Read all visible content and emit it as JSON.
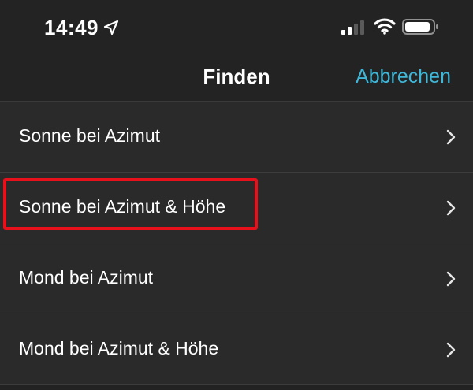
{
  "status_bar": {
    "time": "14:49",
    "icons": [
      "location-arrow-icon",
      "signal-icon",
      "wifi-icon",
      "battery-icon"
    ]
  },
  "nav": {
    "title": "Finden",
    "cancel_label": "Abbrechen"
  },
  "list": {
    "items": [
      {
        "label": "Sonne bei Azimut"
      },
      {
        "label": "Sonne bei Azimut & Höhe"
      },
      {
        "label": "Mond bei Azimut"
      },
      {
        "label": "Mond bei Azimut & Höhe"
      }
    ]
  },
  "colors": {
    "background": "#222222",
    "row_background": "#2a2a2a",
    "accent": "#3fb7d9",
    "highlight": "#e8101a",
    "text": "#ffffff"
  }
}
